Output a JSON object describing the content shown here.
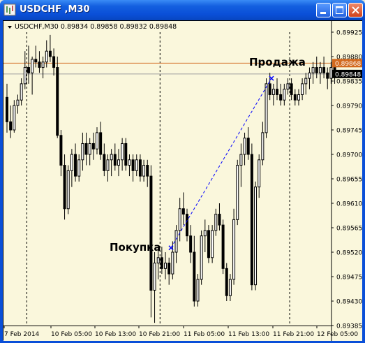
{
  "window": {
    "title": "USDCHF ,M30"
  },
  "chart_header": {
    "symbol": "USDCHF,M30",
    "open": "0.89834",
    "high": "0.89858",
    "low": "0.89832",
    "close": "0.89848"
  },
  "annotations": {
    "sell_label": "Продажа",
    "buy_label": "Покупка"
  },
  "chart_data": {
    "type": "candlestick",
    "ylim": [
      0.89385,
      0.89925
    ],
    "y_ticks": [
      "0.89925",
      "0.89880",
      "0.89835",
      "0.89790",
      "0.89745",
      "0.89700",
      "0.89655",
      "0.89610",
      "0.89565",
      "0.89520",
      "0.89475",
      "0.89430",
      "0.89385"
    ],
    "x_ticks": [
      "7 Feb 2014",
      "10 Feb 05:00",
      "10 Feb 13:00",
      "10 Feb 21:00",
      "11 Feb 05:00",
      "11 Feb 13:00",
      "11 Feb 21:00",
      "12 Feb 05:00"
    ],
    "price_labels": [
      {
        "price": 0.89868,
        "text": "0.89868",
        "color": "#D2691E"
      },
      {
        "price": 0.89848,
        "text": "0.89848",
        "color": "#000000"
      }
    ],
    "hlines": [
      {
        "price": 0.89868,
        "color": "#D2691E"
      },
      {
        "price": 0.89848,
        "color": "#A0A0A0"
      }
    ],
    "buy_point": 0.89528,
    "sell_point": 0.8984,
    "candles": [
      [
        0.89805,
        0.8983,
        0.8974,
        0.8976
      ],
      [
        0.8976,
        0.8979,
        0.8973,
        0.89745
      ],
      [
        0.89745,
        0.898,
        0.8974,
        0.8979
      ],
      [
        0.8979,
        0.8981,
        0.89775,
        0.898
      ],
      [
        0.898,
        0.8984,
        0.8979,
        0.8983
      ],
      [
        0.8983,
        0.8989,
        0.8982,
        0.8986
      ],
      [
        0.8986,
        0.899,
        0.8983,
        0.8985
      ],
      [
        0.8985,
        0.8988,
        0.8981,
        0.89875
      ],
      [
        0.89875,
        0.899,
        0.8986,
        0.8987
      ],
      [
        0.8987,
        0.8989,
        0.8985,
        0.8986
      ],
      [
        0.8986,
        0.8988,
        0.8984,
        0.8987
      ],
      [
        0.8987,
        0.8991,
        0.8986,
        0.8989
      ],
      [
        0.8989,
        0.8992,
        0.8987,
        0.8988
      ],
      [
        0.8988,
        0.89895,
        0.89845,
        0.8986
      ],
      [
        0.8986,
        0.8988,
        0.8973,
        0.89735
      ],
      [
        0.89735,
        0.89745,
        0.8966,
        0.8968
      ],
      [
        0.8968,
        0.897,
        0.8958,
        0.896
      ],
      [
        0.896,
        0.8968,
        0.8959,
        0.8967
      ],
      [
        0.8967,
        0.8971,
        0.8964,
        0.897
      ],
      [
        0.897,
        0.8972,
        0.8965,
        0.8966
      ],
      [
        0.8966,
        0.897,
        0.8965,
        0.8969
      ],
      [
        0.8969,
        0.8974,
        0.8967,
        0.8972
      ],
      [
        0.8972,
        0.8974,
        0.8968,
        0.897
      ],
      [
        0.897,
        0.8973,
        0.8968,
        0.8972
      ],
      [
        0.8972,
        0.8974,
        0.8969,
        0.8971
      ],
      [
        0.8971,
        0.8975,
        0.897,
        0.8974
      ],
      [
        0.8974,
        0.8976,
        0.8969,
        0.897
      ],
      [
        0.897,
        0.8972,
        0.8966,
        0.8967
      ],
      [
        0.8967,
        0.897,
        0.8965,
        0.8969
      ],
      [
        0.8969,
        0.8971,
        0.8966,
        0.897
      ],
      [
        0.897,
        0.8972,
        0.8967,
        0.8968
      ],
      [
        0.8968,
        0.8971,
        0.8966,
        0.8969
      ],
      [
        0.8969,
        0.8973,
        0.8967,
        0.8972
      ],
      [
        0.8972,
        0.8973,
        0.8967,
        0.8968
      ],
      [
        0.8968,
        0.897,
        0.8966,
        0.8969
      ],
      [
        0.8969,
        0.897,
        0.8965,
        0.8967
      ],
      [
        0.8967,
        0.897,
        0.8966,
        0.8969
      ],
      [
        0.8969,
        0.897,
        0.8965,
        0.8966
      ],
      [
        0.8966,
        0.8969,
        0.8965,
        0.8968
      ],
      [
        0.8968,
        0.8969,
        0.8964,
        0.8966
      ],
      [
        0.8966,
        0.8968,
        0.894,
        0.8945
      ],
      [
        0.8945,
        0.8952,
        0.8939,
        0.895
      ],
      [
        0.895,
        0.8953,
        0.8947,
        0.8951
      ],
      [
        0.8951,
        0.8953,
        0.8948,
        0.8949
      ],
      [
        0.8949,
        0.8952,
        0.8947,
        0.895
      ],
      [
        0.895,
        0.8951,
        0.8946,
        0.8948
      ],
      [
        0.8948,
        0.8954,
        0.8947,
        0.8952
      ],
      [
        0.8952,
        0.8957,
        0.895,
        0.8956
      ],
      [
        0.8956,
        0.8962,
        0.8954,
        0.896
      ],
      [
        0.896,
        0.8963,
        0.8957,
        0.8959
      ],
      [
        0.8959,
        0.896,
        0.8954,
        0.8955
      ],
      [
        0.8955,
        0.8957,
        0.895,
        0.8952
      ],
      [
        0.8952,
        0.8955,
        0.8942,
        0.8943
      ],
      [
        0.8943,
        0.8948,
        0.8942,
        0.8947
      ],
      [
        0.8947,
        0.8956,
        0.8946,
        0.8955
      ],
      [
        0.8955,
        0.8958,
        0.8952,
        0.8956
      ],
      [
        0.8956,
        0.8957,
        0.895,
        0.8951
      ],
      [
        0.8951,
        0.8957,
        0.895,
        0.8956
      ],
      [
        0.8956,
        0.896,
        0.8955,
        0.8959
      ],
      [
        0.8959,
        0.8961,
        0.8956,
        0.8957
      ],
      [
        0.8957,
        0.8958,
        0.8948,
        0.8949
      ],
      [
        0.8949,
        0.895,
        0.8943,
        0.8944
      ],
      [
        0.8944,
        0.8948,
        0.8943,
        0.8947
      ],
      [
        0.8947,
        0.896,
        0.8946,
        0.8958
      ],
      [
        0.8958,
        0.8969,
        0.8957,
        0.8968
      ],
      [
        0.8968,
        0.8972,
        0.8964,
        0.897
      ],
      [
        0.897,
        0.8974,
        0.8968,
        0.8973
      ],
      [
        0.8973,
        0.8975,
        0.8969,
        0.897
      ],
      [
        0.897,
        0.8972,
        0.8945,
        0.8946
      ],
      [
        0.8946,
        0.8965,
        0.8945,
        0.8964
      ],
      [
        0.8964,
        0.897,
        0.8962,
        0.8969
      ],
      [
        0.8969,
        0.8976,
        0.8968,
        0.8974
      ],
      [
        0.8974,
        0.8984,
        0.8973,
        0.8983
      ],
      [
        0.8983,
        0.8985,
        0.898,
        0.8981
      ],
      [
        0.8981,
        0.8983,
        0.8979,
        0.8982
      ],
      [
        0.8982,
        0.8984,
        0.898,
        0.8981
      ],
      [
        0.8981,
        0.8983,
        0.8979,
        0.898
      ],
      [
        0.898,
        0.8983,
        0.8979,
        0.8982
      ],
      [
        0.8982,
        0.8984,
        0.8981,
        0.8983
      ],
      [
        0.8983,
        0.8984,
        0.898,
        0.8981
      ],
      [
        0.8981,
        0.8982,
        0.8979,
        0.898
      ],
      [
        0.898,
        0.8982,
        0.8979,
        0.8981
      ],
      [
        0.8981,
        0.8984,
        0.898,
        0.8983
      ],
      [
        0.8983,
        0.8985,
        0.8981,
        0.8984
      ],
      [
        0.8984,
        0.8986,
        0.8982,
        0.8985
      ],
      [
        0.8985,
        0.8987,
        0.8983,
        0.8986
      ],
      [
        0.8986,
        0.8988,
        0.8984,
        0.8985
      ],
      [
        0.8985,
        0.8987,
        0.8983,
        0.8986
      ],
      [
        0.8986,
        0.8988,
        0.8984,
        0.8985
      ],
      [
        0.8985,
        0.8986,
        0.8982,
        0.8984
      ],
      [
        0.8984,
        0.8987,
        0.8983,
        0.8986
      ],
      [
        0.8986,
        0.8987,
        0.8983,
        0.89848
      ]
    ]
  }
}
